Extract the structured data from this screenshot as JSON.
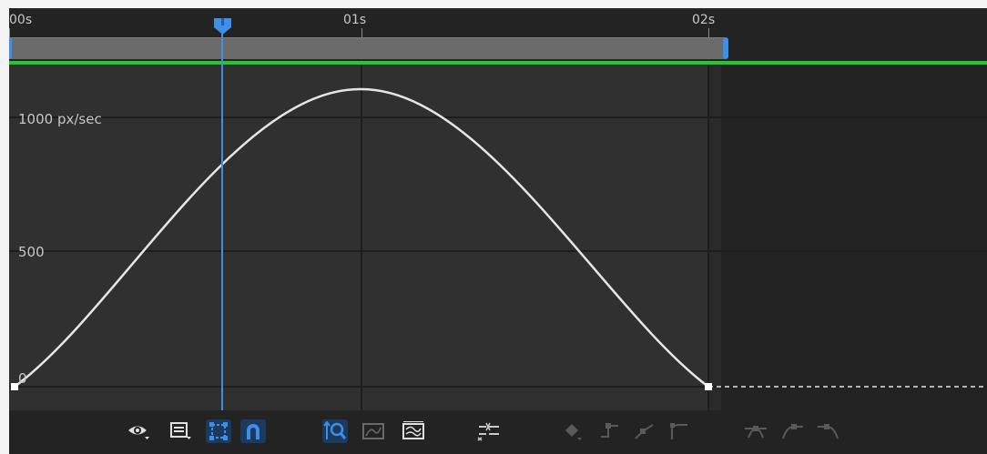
{
  "timeline": {
    "ruler": {
      "labels": [
        "00s",
        "01s",
        "02s"
      ]
    },
    "playhead_time": "00:00:00:06"
  },
  "graph": {
    "y_axis_labels": [
      "1000 px/sec",
      "500",
      "0"
    ],
    "curve_type": "speed graph",
    "colors": {
      "background": "#232323",
      "plot_area": "#303030",
      "curve": "#e6e6e6",
      "grid": "#1d1d1d",
      "playhead": "#3d8fe8",
      "work_area_bar": "#22c92c"
    }
  },
  "toolbar": {
    "tools": [
      {
        "name": "choose-properties-visible",
        "icon": "eye-icon",
        "active": false
      },
      {
        "name": "graph-type-options",
        "icon": "graph-options-icon",
        "active": false
      },
      {
        "name": "transform-box",
        "icon": "transform-box-icon",
        "active": true
      },
      {
        "name": "snap",
        "icon": "magnet-icon",
        "active": true
      },
      {
        "name": "auto-zoom-height",
        "icon": "zoom-height-icon",
        "active": true
      },
      {
        "name": "fit-selection",
        "icon": "fit-selection-icon",
        "active": false
      },
      {
        "name": "fit-all",
        "icon": "fit-all-icon",
        "active": false
      },
      {
        "name": "separate-dimensions",
        "icon": "separate-dimensions-icon",
        "active": false
      },
      {
        "name": "edit-keyframe",
        "icon": "keyframe-diamond-icon",
        "active": false
      },
      {
        "name": "convert-hold",
        "icon": "hold-keyframe-icon",
        "active": false
      },
      {
        "name": "convert-linear",
        "icon": "linear-keyframe-icon",
        "active": false
      },
      {
        "name": "convert-auto-bezier",
        "icon": "auto-bezier-icon",
        "active": false
      },
      {
        "name": "easy-ease",
        "icon": "easy-ease-icon",
        "active": false
      },
      {
        "name": "easy-ease-in",
        "icon": "easy-ease-in-icon",
        "active": false
      },
      {
        "name": "easy-ease-out",
        "icon": "easy-ease-out-icon",
        "active": false
      }
    ]
  }
}
